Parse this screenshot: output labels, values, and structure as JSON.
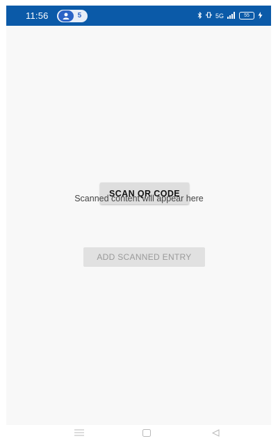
{
  "status_bar": {
    "time": "11:56",
    "notification_count": "5",
    "network": "5G",
    "battery_level": "55",
    "background_color": "#0b5aa8"
  },
  "main": {
    "scan_button_label": "SCAN QR CODE",
    "scanned_placeholder": "Scanned content will appear here",
    "add_button_label": "ADD SCANNED ENTRY"
  },
  "nav_bar": {
    "icons": [
      "menu-icon",
      "home-icon",
      "back-icon"
    ]
  }
}
